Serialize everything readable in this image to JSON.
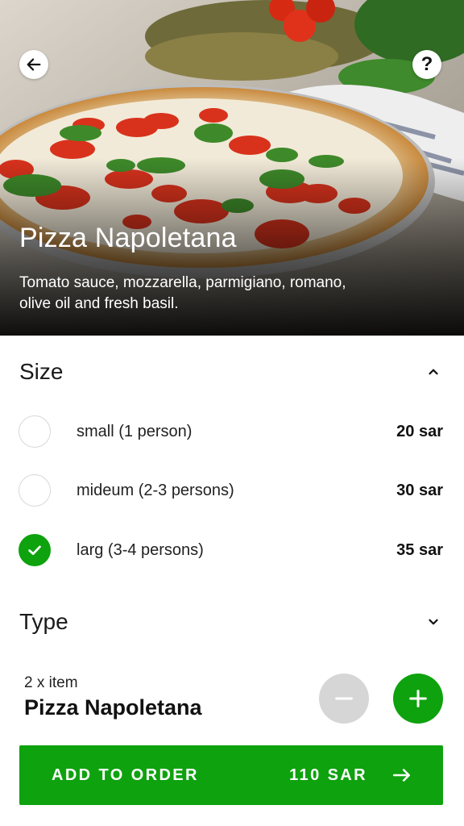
{
  "hero": {
    "title": "Pizza Napoletana",
    "description": "Tomato sauce, mozzarella, parmigiano, romano, olive oil and fresh basil."
  },
  "icons": {
    "back": "arrow-left-icon",
    "help": "question-mark-icon",
    "collapse": "chevron-up-icon",
    "expand": "chevron-down-icon",
    "check": "check-icon",
    "minus": "minus-icon",
    "plus": "plus-icon",
    "order_arrow": "arrow-right-icon"
  },
  "size_section": {
    "title": "Size",
    "expanded": true,
    "options": [
      {
        "label": "small (1 person)",
        "price": "20 sar",
        "selected": false
      },
      {
        "label": "mideum (2-3 persons)",
        "price": "30 sar",
        "selected": false
      },
      {
        "label": "larg (3-4 persons)",
        "price": "35 sar",
        "selected": true
      }
    ]
  },
  "type_section": {
    "title": "Type",
    "expanded": false
  },
  "summary": {
    "quantity_text": "2 x item",
    "item_name": "Pizza Napoletana"
  },
  "order_button": {
    "label": "ADD TO ORDER",
    "price": "110 SAR"
  },
  "colors": {
    "accent": "#0ea20e",
    "disabled": "#d6d6d6"
  }
}
